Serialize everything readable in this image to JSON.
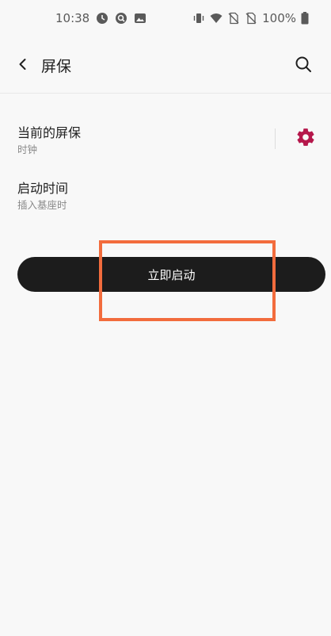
{
  "status_bar": {
    "time": "10:38",
    "battery": "100%",
    "left_icons": [
      "clock-app-icon",
      "quick-search-icon",
      "gallery-icon"
    ],
    "right_icons": [
      "vibrate-icon",
      "wifi-icon",
      "no-sim-icon",
      "no-sim-icon",
      "battery-icon"
    ]
  },
  "app_bar": {
    "title": "屏保",
    "back_icon": "back-arrow-icon",
    "search_icon": "search-icon"
  },
  "settings": {
    "current_screensaver": {
      "title": "当前的屏保",
      "summary": "时钟",
      "action_icon": "gear-icon"
    },
    "when_to_start": {
      "title": "启动时间",
      "summary": "插入基座时"
    }
  },
  "start_now_button": {
    "label": "立即启动"
  },
  "colors": {
    "accent": "#b5174b",
    "button_bg": "#1c1c1c",
    "highlight": "#f26c3d",
    "background": "#f8f8f8"
  }
}
